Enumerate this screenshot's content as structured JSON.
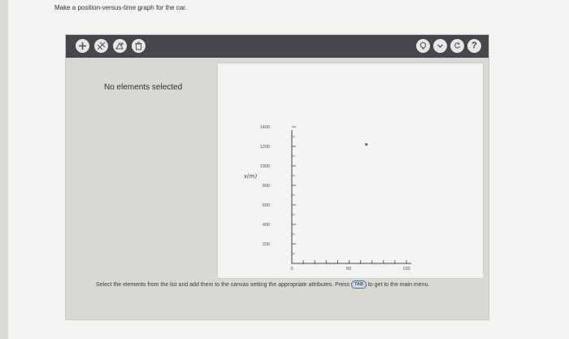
{
  "question": {
    "text": "Make a position-versus-time graph for the car."
  },
  "toolbar": {
    "left_buttons": [
      "plus-icon",
      "line-tool-icon",
      "shape-tool-icon",
      "delete-icon"
    ],
    "right_buttons": [
      "hint-icon",
      "dropdown-icon",
      "reset-icon",
      "help-icon"
    ],
    "help_label": "?"
  },
  "sidebar": {
    "message": "No elements selected"
  },
  "graph": {
    "y_axis_label": "x(m)",
    "y_ticks": [
      "200",
      "400",
      "600",
      "800",
      "1000",
      "1200",
      "1400"
    ],
    "x_ticks": [
      "0",
      "50",
      "100"
    ],
    "plotted_point": {
      "t": 65,
      "x": 1220
    }
  },
  "instructions": {
    "text_before": "Select the elements from the list and add them to the canvas setting the appropriate attributes. Press",
    "key_label": "TAB",
    "text_after": "to get to the main menu."
  }
}
